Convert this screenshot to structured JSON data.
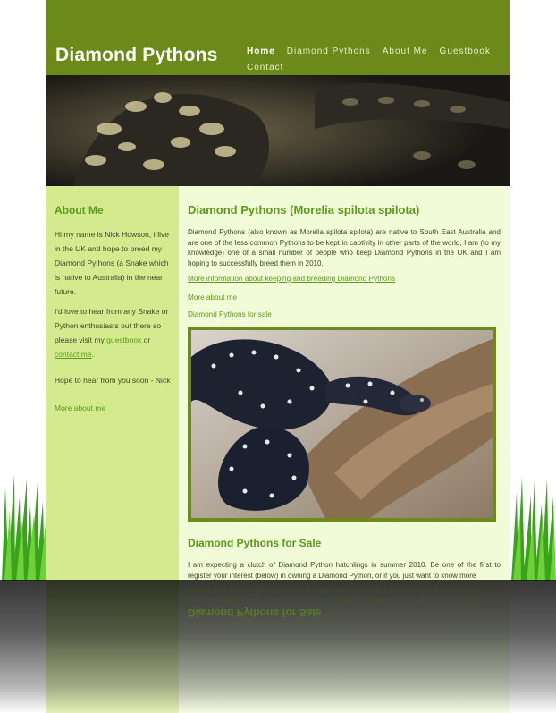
{
  "header": {
    "site_title": "Diamond Pythons",
    "nav": [
      {
        "label": "Home",
        "active": true
      },
      {
        "label": "Diamond Pythons",
        "active": false
      },
      {
        "label": "About Me",
        "active": false
      },
      {
        "label": "Guestbook",
        "active": false
      },
      {
        "label": "Contact",
        "active": false
      }
    ]
  },
  "sidebar": {
    "heading": "About Me",
    "para1": "Hi my name is Nick Howson, I live in the UK and hope to breed my Diamond Pythons (a Snake which is native to Australia) in the near future.",
    "para2_before": "I'd love to hear from any Snake or Python enthusiasts out there so please visit my ",
    "para2_link1": "guestbook",
    "para2_mid": " or ",
    "para2_link2": "contact me",
    "para2_after": ".",
    "para3": "Hope to hear from you soon - Nick",
    "more_link": "More about me"
  },
  "main": {
    "heading": "Diamond Pythons (Morelia spilota spilota)",
    "intro": "Diamond Pythons (also known as Morelia spilota spilota) are native to South East Australia and are one of the less common Pythons to be kept in captivity in other parts of the world, I am (to my knowledge) one of a small number of people who keep Diamond Pythons in the UK and I am hoping to successfully breed them in 2010.",
    "links": [
      "More information about keeping and breeding Diamond Pythons",
      "More about me",
      "Diamond Pythons for sale"
    ],
    "sale_heading": "Diamond Pythons for Sale",
    "sale_text": "I am expecting a clutch of Diamond Python hatchlings in summer 2010. Be one of the first to register your interest (below) in owning a Diamond Python, or if you just want to know more"
  },
  "colors": {
    "header_bg": "#6c8a1a",
    "accent": "#5c9a19",
    "sidebar_bg": "#d4ea8f",
    "main_bg": "#f1fbd7"
  }
}
